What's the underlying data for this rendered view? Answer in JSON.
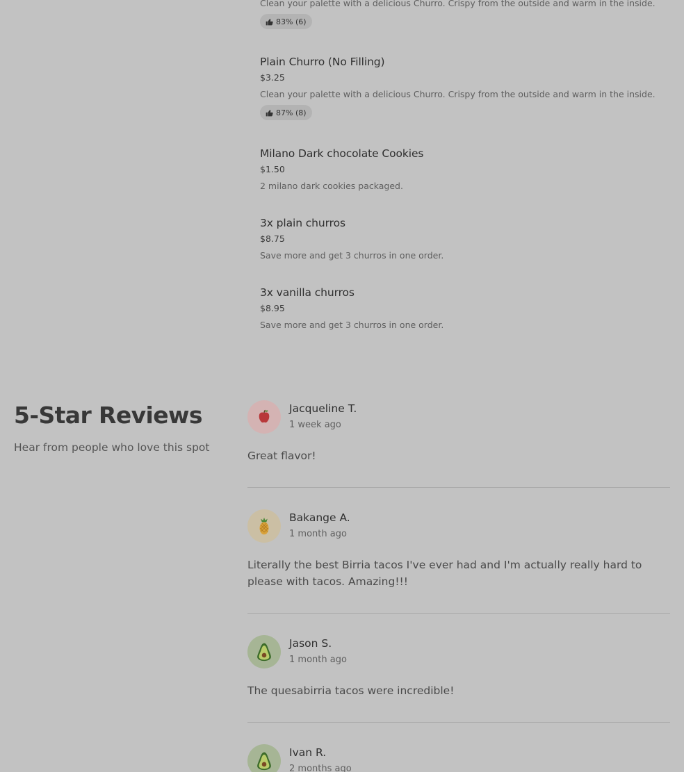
{
  "menu_items": [
    {
      "desc": "Clean your palette with a delicious Churro. Crispy from the outside and warm in the inside.",
      "rating": "83% (6)"
    },
    {
      "name": "Plain Churro (No Filling)",
      "price": "$3.25",
      "desc": "Clean your palette with a delicious Churro. Crispy from the outside and warm in the inside.",
      "rating": "87% (8)"
    },
    {
      "name": "Milano Dark chocolate Cookies",
      "price": "$1.50",
      "desc": "2 milano dark cookies packaged."
    },
    {
      "name": "3x plain churros",
      "price": "$8.75",
      "desc": "Save more and get 3 churros in one order."
    },
    {
      "name": "3x vanilla churros",
      "price": "$8.95",
      "desc": "Save more and get 3 churros in one order."
    }
  ],
  "reviews_section": {
    "title": "5-Star Reviews",
    "subtitle": "Hear from people who love this spot"
  },
  "reviews": [
    {
      "name": "Jacqueline T.",
      "time": "1 week ago",
      "text": "Great flavor!",
      "avatar_icon": "apple-icon",
      "avatar_bg": "#d4b3b3"
    },
    {
      "name": "Bakange A.",
      "time": "1 month ago",
      "text": "Literally the best Birria tacos I've ever had and I'm actually really hard to please with tacos. Amazing!!!",
      "avatar_icon": "pineapple-icon",
      "avatar_bg": "#cbbfa4"
    },
    {
      "name": "Jason S.",
      "time": "1 month ago",
      "text": "The quesabirria tacos were incredible!",
      "avatar_icon": "avocado-icon",
      "avatar_bg": "#a6b595"
    },
    {
      "name": "Ivan R.",
      "time": "2 months ago",
      "avatar_icon": "avocado-icon",
      "avatar_bg": "#a6b595"
    }
  ]
}
